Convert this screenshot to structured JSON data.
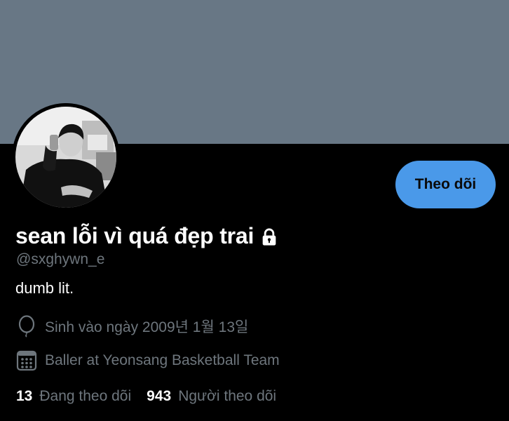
{
  "profile": {
    "display_name": "sean lỗi vì quá đẹp trai",
    "handle": "@sxghywn_e",
    "bio": "dumb lit.",
    "birth": "Sinh vào ngày 2009년 1월 13일",
    "profession": "Baller at Yeonsang Basketball Team"
  },
  "actions": {
    "follow_label": "Theo dõi"
  },
  "stats": {
    "following_count": "13",
    "following_label": "Đang theo dõi",
    "followers_count": "943",
    "followers_label": "Người theo dõi"
  },
  "icons": {
    "lock": "lock-icon",
    "birth": "balloon-icon",
    "profession": "calendar-grid-icon"
  },
  "colors": {
    "banner": "#687785",
    "background": "#000000",
    "accent": "#4a99e9",
    "muted_text": "#6e767d"
  }
}
